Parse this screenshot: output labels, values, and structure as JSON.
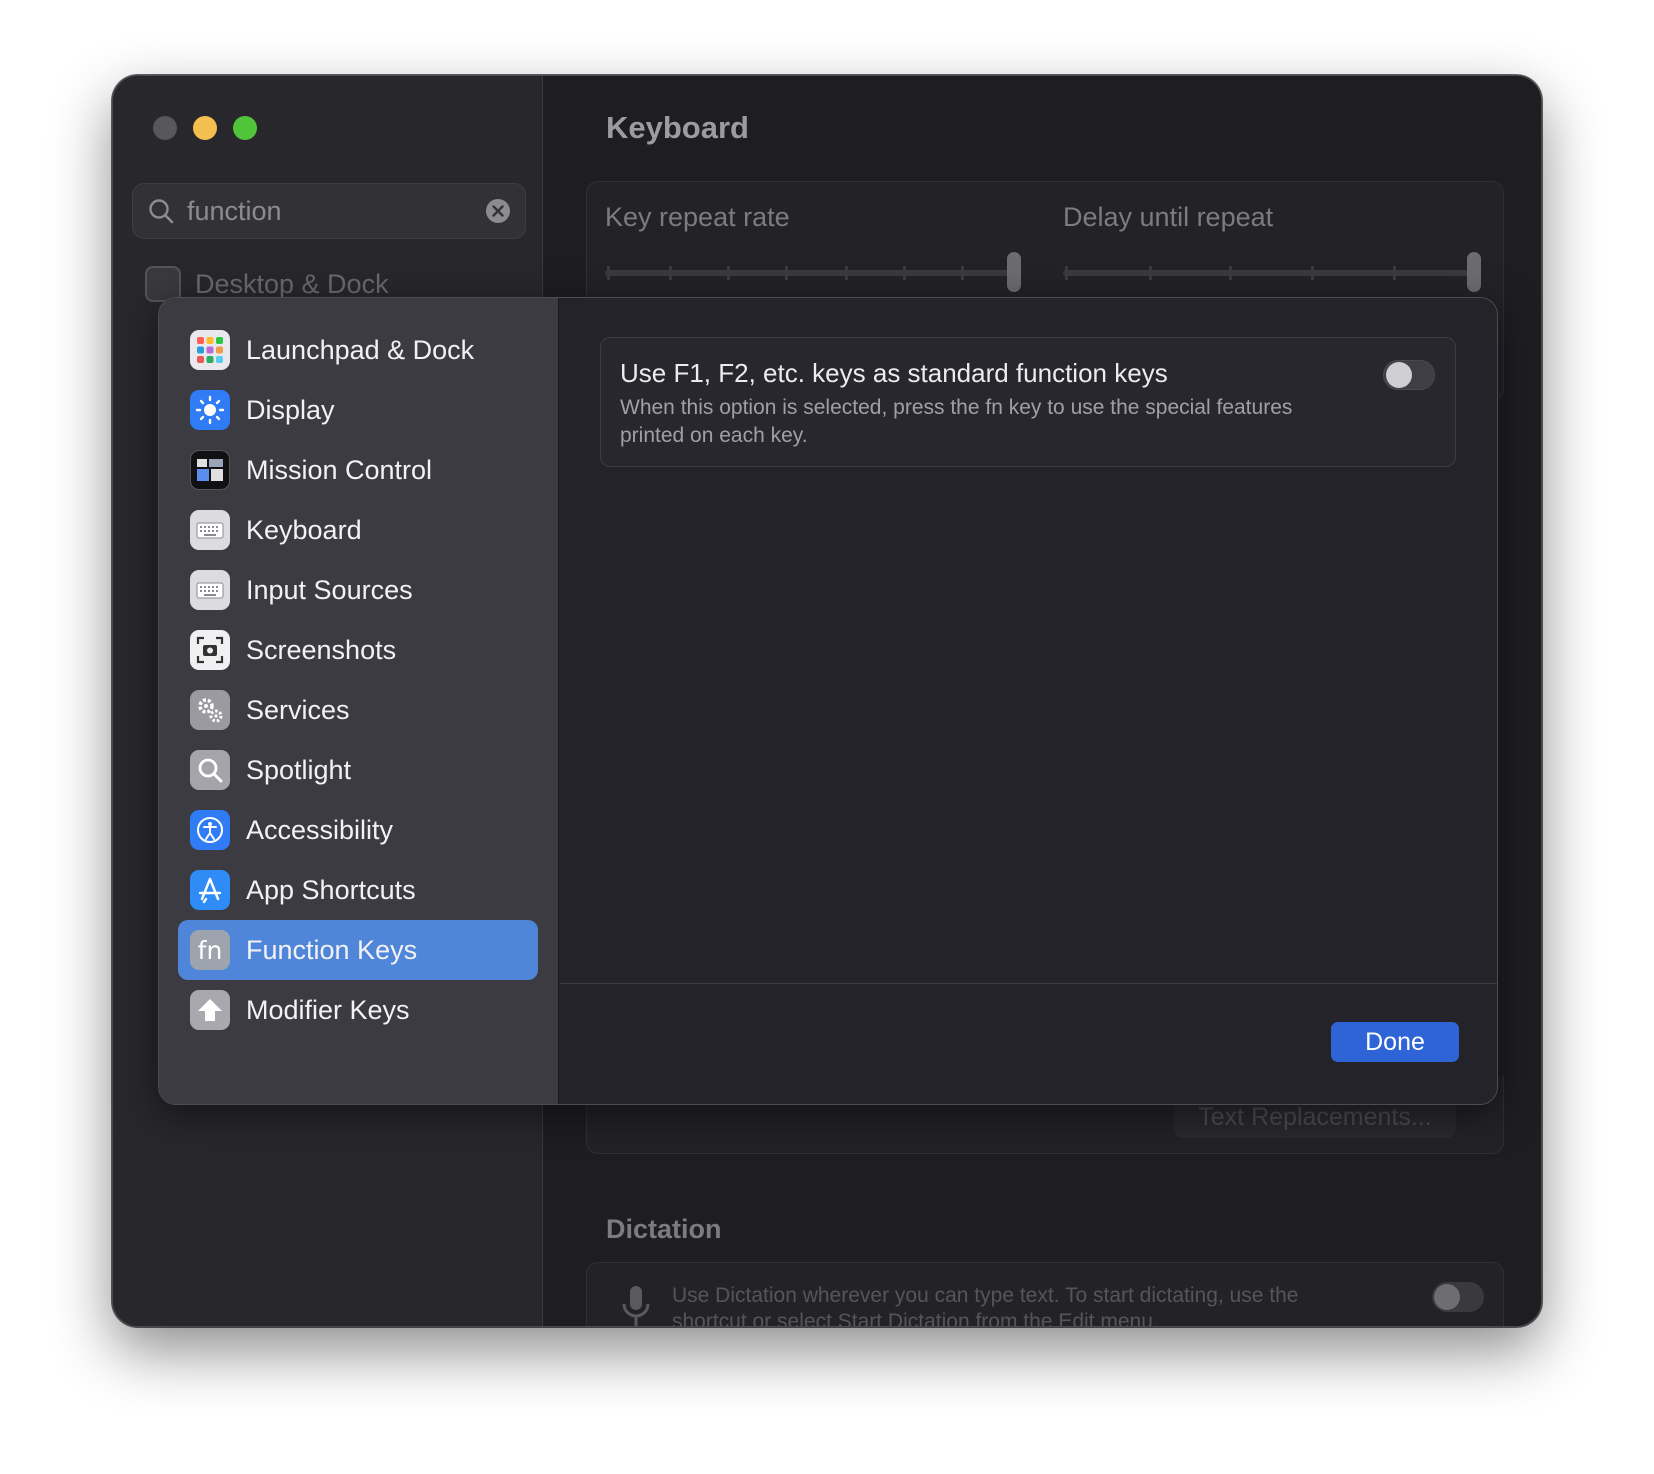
{
  "window": {
    "search": {
      "value": "function"
    },
    "sidebar_background_item": "Desktop & Dock",
    "main_title": "Keyboard",
    "sliders": {
      "key_repeat_label": "Key repeat rate",
      "delay_label": "Delay until repeat"
    },
    "text_replacements_label": "Text Replacements...",
    "dictation_title": "Dictation",
    "dictation_text": "Use Dictation wherever you can type text. To start dictating, use the shortcut or select Start Dictation from the Edit menu."
  },
  "sheet": {
    "categories": [
      {
        "label": "Launchpad & Dock",
        "icon": "launchpad-icon"
      },
      {
        "label": "Display",
        "icon": "display-icon"
      },
      {
        "label": "Mission Control",
        "icon": "mission-control-icon"
      },
      {
        "label": "Keyboard",
        "icon": "keyboard-icon"
      },
      {
        "label": "Input Sources",
        "icon": "input-sources-icon"
      },
      {
        "label": "Screenshots",
        "icon": "screenshots-icon"
      },
      {
        "label": "Services",
        "icon": "services-icon"
      },
      {
        "label": "Spotlight",
        "icon": "spotlight-icon"
      },
      {
        "label": "Accessibility",
        "icon": "accessibility-icon"
      },
      {
        "label": "App Shortcuts",
        "icon": "app-shortcuts-icon"
      },
      {
        "label": "Function Keys",
        "icon": "fn-icon",
        "selected": true
      },
      {
        "label": "Modifier Keys",
        "icon": "modifier-keys-icon"
      }
    ],
    "option": {
      "title": "Use F1, F2, etc. keys as standard function keys",
      "description": "When this option is selected, press the fn key to use the special features printed on each key.",
      "enabled": false
    },
    "done_label": "Done"
  },
  "colors": {
    "accent": "#2f64d6",
    "selection": "#4f86d9",
    "traffic_close": "#58585c",
    "traffic_min": "#f5bf4f",
    "traffic_max": "#52c43a"
  }
}
